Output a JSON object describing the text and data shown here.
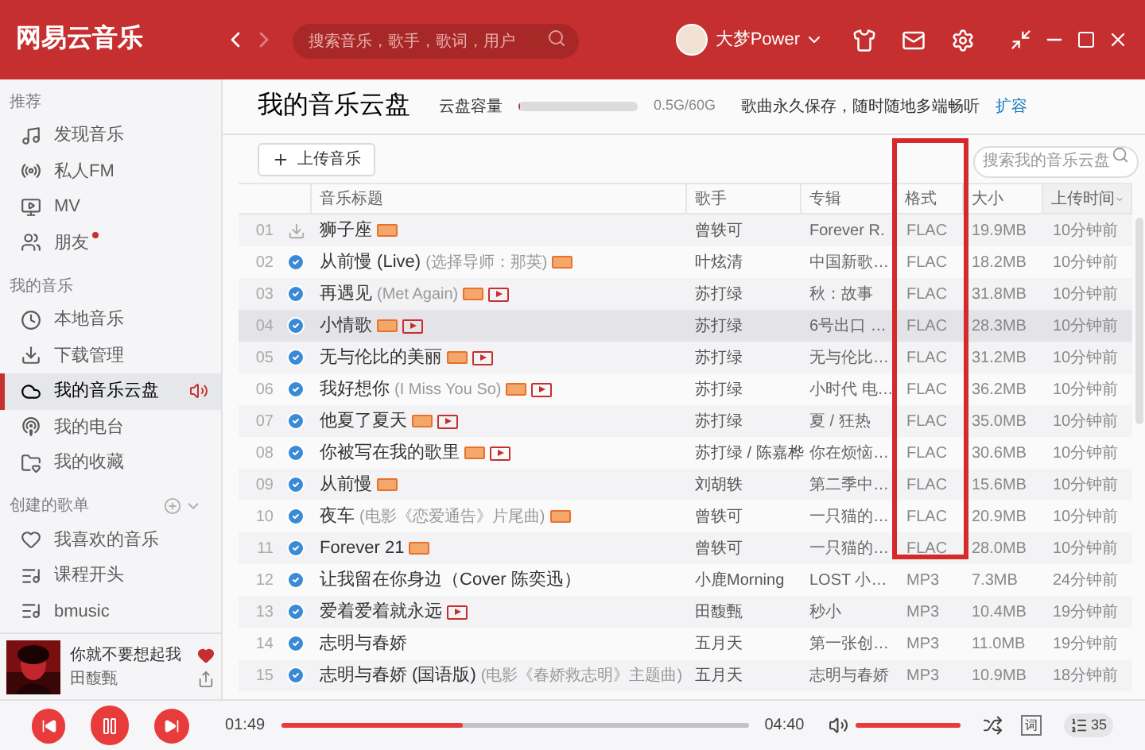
{
  "topbar": {
    "logo": "网易云音乐",
    "search_placeholder": "搜索音乐，歌手，歌词，用户",
    "user": "大梦Power"
  },
  "sidebar": {
    "sections": [
      {
        "heading": "推荐",
        "items": [
          {
            "label": "发现音乐",
            "selected": false,
            "dot": false
          },
          {
            "label": "私人FM",
            "selected": false,
            "dot": false
          },
          {
            "label": "MV",
            "selected": false,
            "dot": false
          },
          {
            "label": "朋友",
            "selected": false,
            "dot": true
          }
        ]
      },
      {
        "heading": "我的音乐",
        "items": [
          {
            "label": "本地音乐",
            "selected": false,
            "dot": false
          },
          {
            "label": "下载管理",
            "selected": false,
            "dot": false
          },
          {
            "label": "我的音乐云盘",
            "selected": true,
            "dot": false
          },
          {
            "label": "我的电台",
            "selected": false,
            "dot": false
          },
          {
            "label": "我的收藏",
            "selected": false,
            "dot": false
          }
        ]
      },
      {
        "heading": "创建的歌单",
        "items": [
          {
            "label": "我喜欢的音乐",
            "selected": false,
            "dot": false
          },
          {
            "label": "课程开头",
            "selected": false,
            "dot": false
          },
          {
            "label": "bmusic",
            "selected": false,
            "dot": false
          }
        ]
      }
    ]
  },
  "now_playing": {
    "title": "你就不要想起我",
    "artist": "田馥甄",
    "liked": true
  },
  "page": {
    "title": "我的音乐云盘",
    "capacity_label": "云盘容量",
    "capacity": {
      "level": 0.01
    },
    "capacity_text": "0.5G/60G",
    "slogan": "歌曲永久保存，随时随地多端畅听",
    "expand_link": "扩容",
    "upload_button": "上传音乐",
    "search_placeholder": "搜索我的音乐云盘"
  },
  "table": {
    "columns": [
      {
        "label": "音乐标题",
        "highlighted": false
      },
      {
        "label": "歌手",
        "highlighted": false
      },
      {
        "label": "专辑",
        "highlighted": false
      },
      {
        "label": "格式",
        "highlighted": true
      },
      {
        "label": "大小",
        "highlighted": false
      },
      {
        "label": "上传时间",
        "highlighted": false
      }
    ],
    "rows": [
      {
        "index": "01",
        "synced": false,
        "title": "狮子座",
        "subtitle": "",
        "sq": true,
        "mv": false,
        "artist": "曾轶可",
        "album": "Forever R.",
        "format": "FLAC",
        "size": "19.9MB",
        "time": "10分钟前",
        "selected": false
      },
      {
        "index": "02",
        "synced": true,
        "title": "从前慢 (Live)",
        "subtitle": "(选择导师：那英)",
        "sq": true,
        "mv": false,
        "artist": "叶炫清",
        "album": "中国新歌…",
        "format": "FLAC",
        "size": "18.2MB",
        "time": "10分钟前",
        "selected": false
      },
      {
        "index": "03",
        "synced": true,
        "title": "再遇见",
        "subtitle": "(Met Again)",
        "sq": true,
        "mv": true,
        "artist": "苏打绿",
        "album": "秋：故事",
        "format": "FLAC",
        "size": "31.8MB",
        "time": "10分钟前",
        "selected": false
      },
      {
        "index": "04",
        "synced": true,
        "title": "小情歌",
        "subtitle": "",
        "sq": true,
        "mv": true,
        "artist": "苏打绿",
        "album": "6号出口 …",
        "format": "FLAC",
        "size": "28.3MB",
        "time": "10分钟前",
        "selected": true
      },
      {
        "index": "05",
        "synced": true,
        "title": "无与伦比的美丽",
        "subtitle": "",
        "sq": true,
        "mv": true,
        "artist": "苏打绿",
        "album": "无与伦比…",
        "format": "FLAC",
        "size": "31.2MB",
        "time": "10分钟前",
        "selected": false
      },
      {
        "index": "06",
        "synced": true,
        "title": "我好想你",
        "subtitle": "(I Miss You So)",
        "sq": true,
        "mv": true,
        "artist": "苏打绿",
        "album": "小时代 电…",
        "format": "FLAC",
        "size": "36.2MB",
        "time": "10分钟前",
        "selected": false
      },
      {
        "index": "07",
        "synced": true,
        "title": "他夏了夏天",
        "subtitle": "",
        "sq": true,
        "mv": true,
        "artist": "苏打绿",
        "album": "夏 / 狂热",
        "format": "FLAC",
        "size": "35.0MB",
        "time": "10分钟前",
        "selected": false
      },
      {
        "index": "08",
        "synced": true,
        "title": "你被写在我的歌里",
        "subtitle": "",
        "sq": true,
        "mv": true,
        "artist": "苏打绿 / 陈嘉桦",
        "album": "你在烦恼…",
        "format": "FLAC",
        "size": "30.6MB",
        "time": "10分钟前",
        "selected": false
      },
      {
        "index": "09",
        "synced": true,
        "title": "从前慢",
        "subtitle": "",
        "sq": true,
        "mv": false,
        "artist": "刘胡轶",
        "album": "第二季中…",
        "format": "FLAC",
        "size": "15.6MB",
        "time": "10分钟前",
        "selected": false
      },
      {
        "index": "10",
        "synced": true,
        "title": "夜车",
        "subtitle": "(电影《恋爱通告》片尾曲)",
        "sq": true,
        "mv": false,
        "artist": "曾轶可",
        "album": "一只猫的…",
        "format": "FLAC",
        "size": "20.9MB",
        "time": "10分钟前",
        "selected": false
      },
      {
        "index": "11",
        "synced": true,
        "title": "Forever 21",
        "subtitle": "",
        "sq": true,
        "mv": false,
        "artist": "曾轶可",
        "album": "一只猫的…",
        "format": "FLAC",
        "size": "28.0MB",
        "time": "10分钟前",
        "selected": false
      },
      {
        "index": "12",
        "synced": true,
        "title": "让我留在你身边（Cover 陈奕迅）",
        "subtitle": "",
        "sq": false,
        "mv": false,
        "artist": "小鹿Morning",
        "album": "LOST 小…",
        "format": "MP3",
        "size": "7.3MB",
        "time": "24分钟前",
        "selected": false
      },
      {
        "index": "13",
        "synced": true,
        "title": "爱着爱着就永远",
        "subtitle": "",
        "sq": false,
        "mv": true,
        "artist": "田馥甄",
        "album": "秒小",
        "format": "MP3",
        "size": "10.4MB",
        "time": "19分钟前",
        "selected": false
      },
      {
        "index": "14",
        "synced": true,
        "title": "志明与春娇",
        "subtitle": "",
        "sq": false,
        "mv": false,
        "artist": "五月天",
        "album": "第一张创…",
        "format": "MP3",
        "size": "11.0MB",
        "time": "19分钟前",
        "selected": false
      },
      {
        "index": "15",
        "synced": true,
        "title": "志明与春娇 (国语版)",
        "subtitle": "(电影《春娇救志明》主题曲)",
        "sq": false,
        "mv": false,
        "artist": "五月天",
        "album": "志明与春娇",
        "format": "MP3",
        "size": "10.9MB",
        "time": "18分钟前",
        "selected": false
      }
    ]
  },
  "player": {
    "elapsed": "01:49",
    "progress": {
      "level": 0.39
    },
    "duration": "04:40",
    "volume": {
      "level": 1
    },
    "lyrics_button": "词",
    "queue_count": "35"
  }
}
